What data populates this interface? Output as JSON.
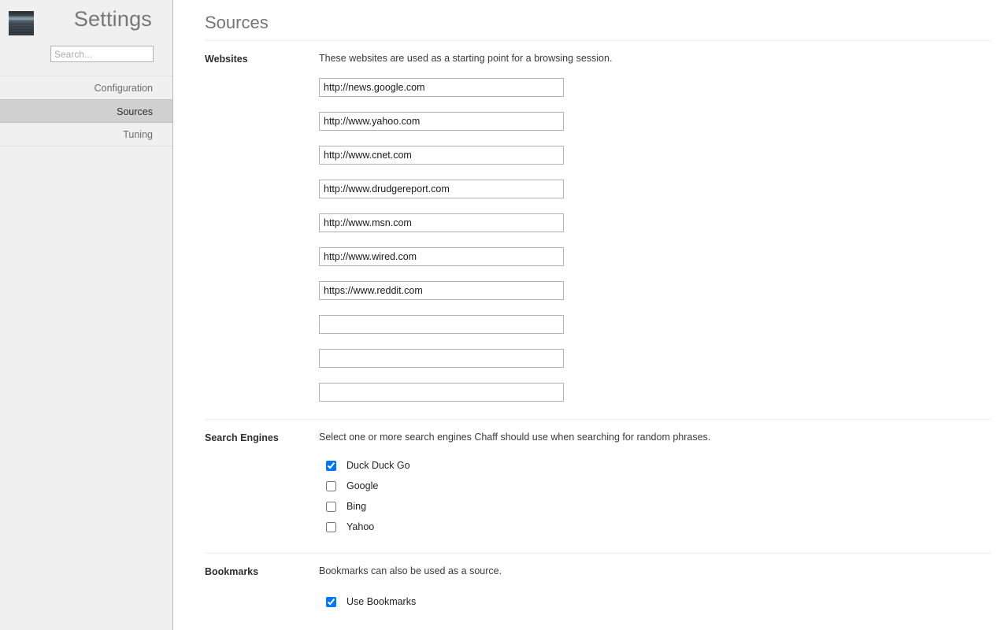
{
  "sidebar": {
    "logo_icon": "app-thumbnail-icon",
    "title": "Settings",
    "search": {
      "placeholder": "Search...",
      "value": ""
    },
    "items": [
      {
        "label": "Configuration",
        "selected": false
      },
      {
        "label": "Sources",
        "selected": true
      },
      {
        "label": "Tuning",
        "selected": false
      }
    ]
  },
  "main": {
    "page_title": "Sources",
    "sections": {
      "websites": {
        "label": "Websites",
        "description": "These websites are used as a starting point for a browsing session.",
        "inputs": [
          "http://news.google.com",
          "http://www.yahoo.com",
          "http://www.cnet.com",
          "http://www.drudgereport.com",
          "http://www.msn.com",
          "http://www.wired.com",
          "https://www.reddit.com",
          "",
          "",
          ""
        ]
      },
      "search_engines": {
        "label": "Search Engines",
        "description": "Select one or more search engines Chaff should use when searching for random phrases.",
        "options": [
          {
            "label": "Duck Duck Go",
            "checked": true
          },
          {
            "label": "Google",
            "checked": false
          },
          {
            "label": "Bing",
            "checked": false
          },
          {
            "label": "Yahoo",
            "checked": false
          }
        ]
      },
      "bookmarks": {
        "label": "Bookmarks",
        "description": "Bookmarks can also be used as a source.",
        "options": [
          {
            "label": "Use Bookmarks",
            "checked": true
          }
        ]
      }
    }
  },
  "colors": {
    "sidebar_bg": "#f0f0f0",
    "sidebar_selected_bg": "#d0d0d0",
    "main_bg": "#ffffff",
    "title_text": "#757575",
    "divider": "#ececec",
    "input_border": "#b3b3b3"
  }
}
